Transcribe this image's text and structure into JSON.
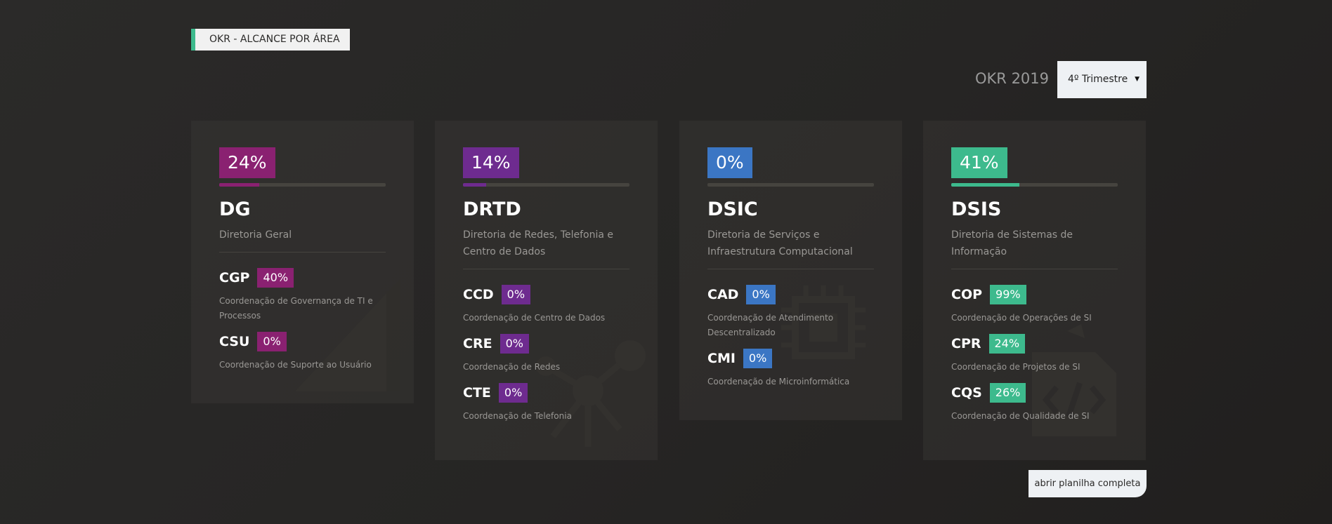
{
  "section_tag": "OKR - ALCANCE POR ÁREA",
  "period": {
    "label": "OKR 2019",
    "selected": "4º Trimestre"
  },
  "colors": {
    "dg": "#8a2171",
    "drtd": "#6e2b8f",
    "dsic": "#3b76c4",
    "dsis": "#3dba8d"
  },
  "cards": [
    {
      "percent": "24%",
      "progress": 0.24,
      "code": "DG",
      "name": "Diretoria Geral",
      "icon": "letter-a-icon",
      "units": [
        {
          "code": "CGP",
          "percent": "40%",
          "name": "Coordenação de Governança de TI e Processos"
        },
        {
          "code": "CSU",
          "percent": "0%",
          "name": "Coordenação de Suporte ao Usuário"
        }
      ]
    },
    {
      "percent": "14%",
      "progress": 0.14,
      "code": "DRTD",
      "name": "Diretoria de Redes, Telefonia e Centro de Dados",
      "icon": "network-icon",
      "units": [
        {
          "code": "CCD",
          "percent": "0%",
          "name": "Coordenação de Centro de Dados"
        },
        {
          "code": "CRE",
          "percent": "0%",
          "name": "Coordenação de Redes"
        },
        {
          "code": "CTE",
          "percent": "0%",
          "name": "Coordenação de Telefonia"
        }
      ]
    },
    {
      "percent": "0%",
      "progress": 0,
      "code": "DSIC",
      "name": "Diretoria de Serviços e Infraestrutura Computacional",
      "icon": "chip-icon",
      "units": [
        {
          "code": "CAD",
          "percent": "0%",
          "name": "Coordenação de Atendimento Descentralizado"
        },
        {
          "code": "CMI",
          "percent": "0%",
          "name": "Coordenação de Microinformática"
        }
      ]
    },
    {
      "percent": "41%",
      "progress": 0.41,
      "code": "DSIS",
      "name": "Diretoria de Sistemas de Informação",
      "icon": "code-file-icon",
      "units": [
        {
          "code": "COP",
          "percent": "99%",
          "name": "Coordenação de Operações de SI"
        },
        {
          "code": "CPR",
          "percent": "24%",
          "name": "Coordenação de Projetos de SI"
        },
        {
          "code": "CQS",
          "percent": "26%",
          "name": "Coordenação de Qualidade de SI"
        }
      ]
    }
  ],
  "open_sheet_label": "abrir planilha completa"
}
